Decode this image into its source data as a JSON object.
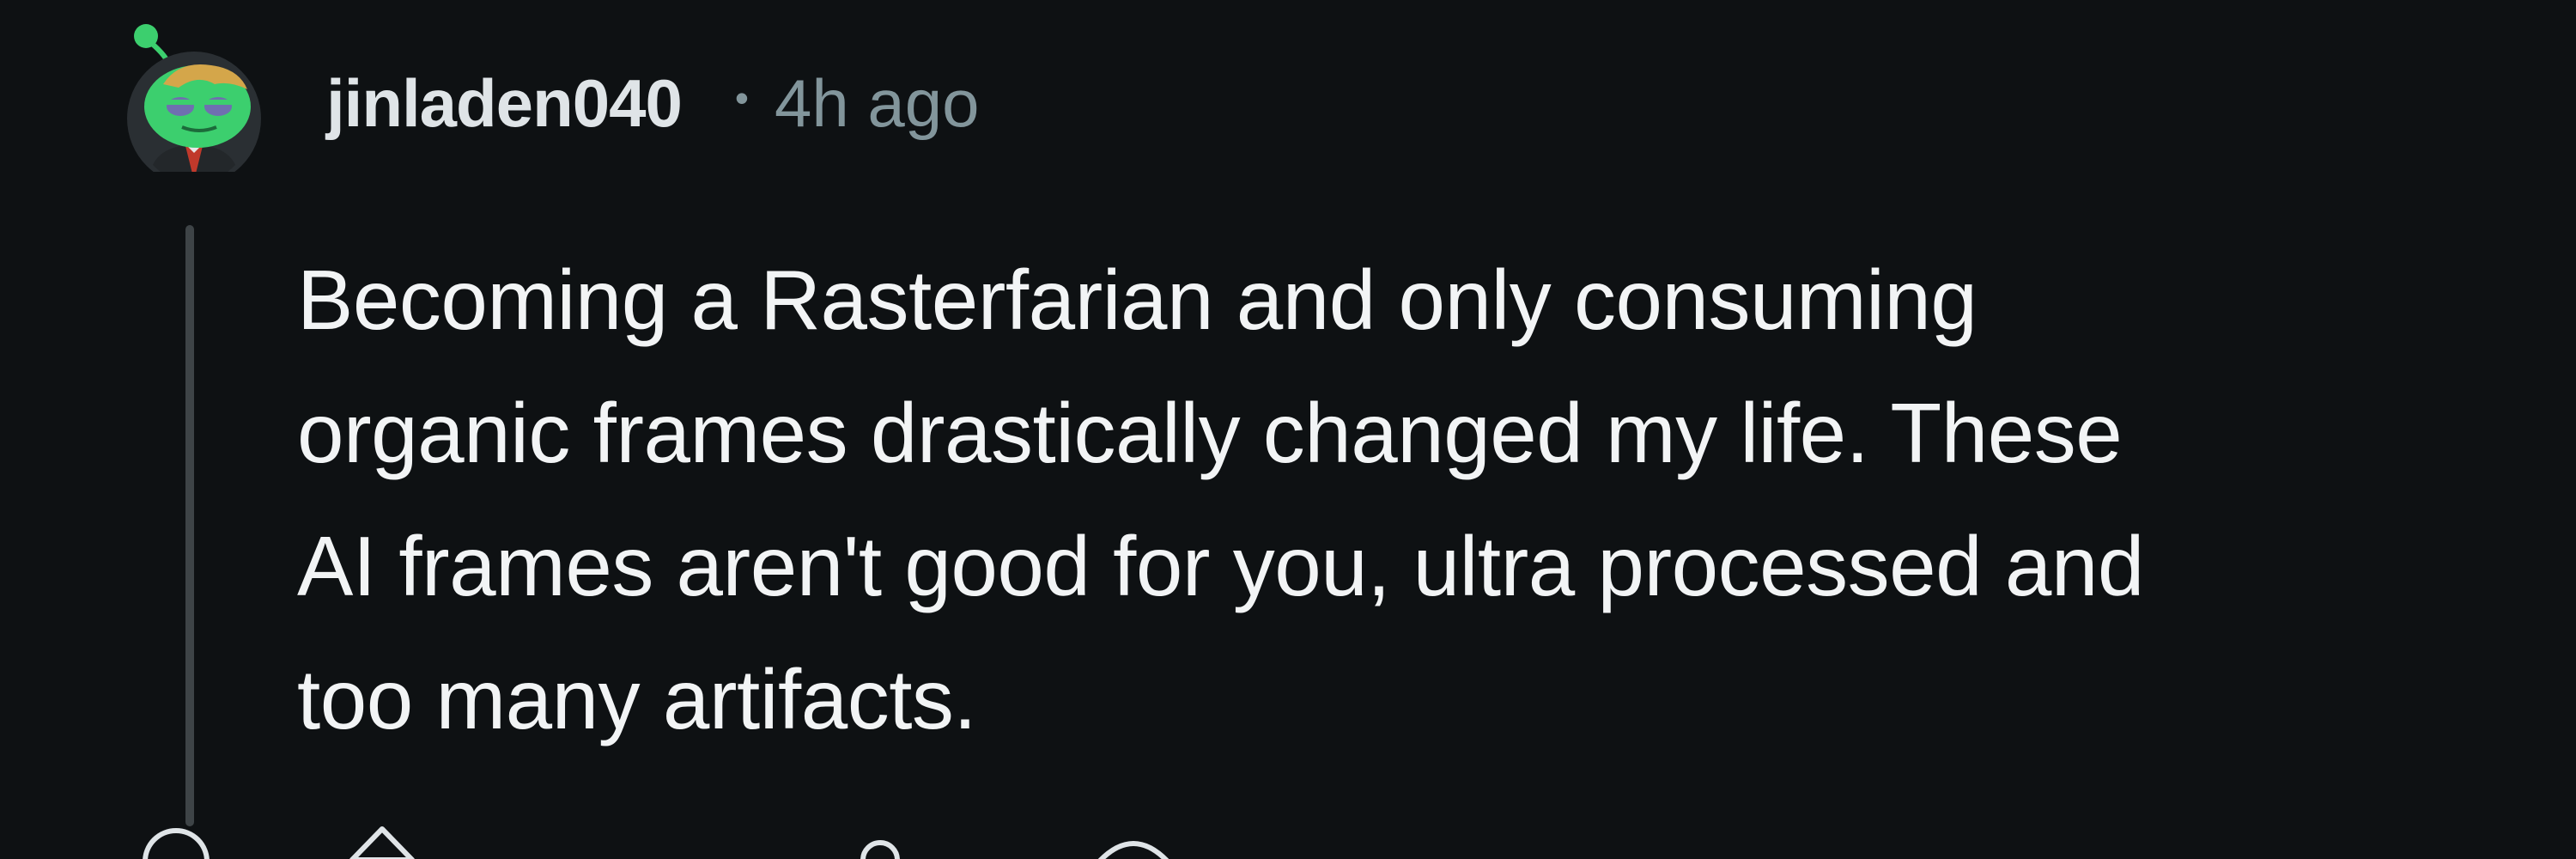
{
  "comment": {
    "author": "jinladen040",
    "separator": "•",
    "timestamp": "4h ago",
    "body_lines": [
      "Becoming a Rasterfarian and only consuming",
      "organic frames drastically changed my life. These",
      "AI frames aren't good for you, ultra processed and",
      "too many artifacts."
    ]
  },
  "icons": {
    "avatar": "snoo-avatar-icon",
    "collapse": "collapse-thread-icon",
    "upvote": "upvote-arrow-icon",
    "award": "award-icon",
    "reply": "reply-bubble-icon"
  },
  "colors": {
    "background": "#0e1113",
    "username": "#dfe4e7",
    "meta": "#82959b",
    "body": "#f2f4f5",
    "thread_line": "#3e4447",
    "avatar_green": "#3ccf6e"
  }
}
